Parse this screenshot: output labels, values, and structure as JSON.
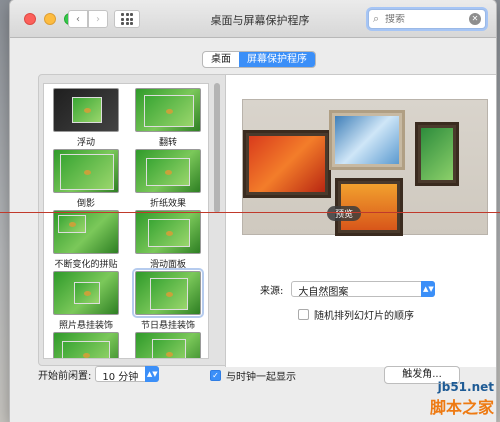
{
  "window": {
    "title": "桌面与屏幕保护程序"
  },
  "search": {
    "placeholder": "搜索"
  },
  "tabs": [
    {
      "label": "桌面",
      "active": false
    },
    {
      "label": "屏幕保护程序",
      "active": true
    }
  ],
  "savers": [
    {
      "label": "浮动",
      "style": "dark"
    },
    {
      "label": "翻转",
      "style": "green"
    },
    {
      "label": "倒影",
      "style": "green"
    },
    {
      "label": "折纸效果",
      "style": "green"
    },
    {
      "label": "不断变化的拼贴",
      "style": "green"
    },
    {
      "label": "滑动面板",
      "style": "green"
    },
    {
      "label": "照片悬挂装饰",
      "style": "green"
    },
    {
      "label": "节日悬挂装饰",
      "style": "green",
      "selected": true
    },
    {
      "label": "",
      "style": "green"
    },
    {
      "label": "",
      "style": "green"
    }
  ],
  "preview": {
    "button_label": "预览"
  },
  "source": {
    "label": "来源:",
    "value": "大自然图案"
  },
  "shuffle": {
    "label": "随机排列幻灯片的顺序",
    "checked": false
  },
  "idle": {
    "label": "开始前闲置:",
    "value": "10 分钟"
  },
  "clock": {
    "label": "与时钟一起显示",
    "checked": true
  },
  "hot_corners": {
    "label": "触发角..."
  },
  "watermark": {
    "url": "jb51.net",
    "text": "脚本之家"
  },
  "colors": {
    "accent": "#3b8ff8",
    "watermark_orange": "#ee7a12"
  }
}
